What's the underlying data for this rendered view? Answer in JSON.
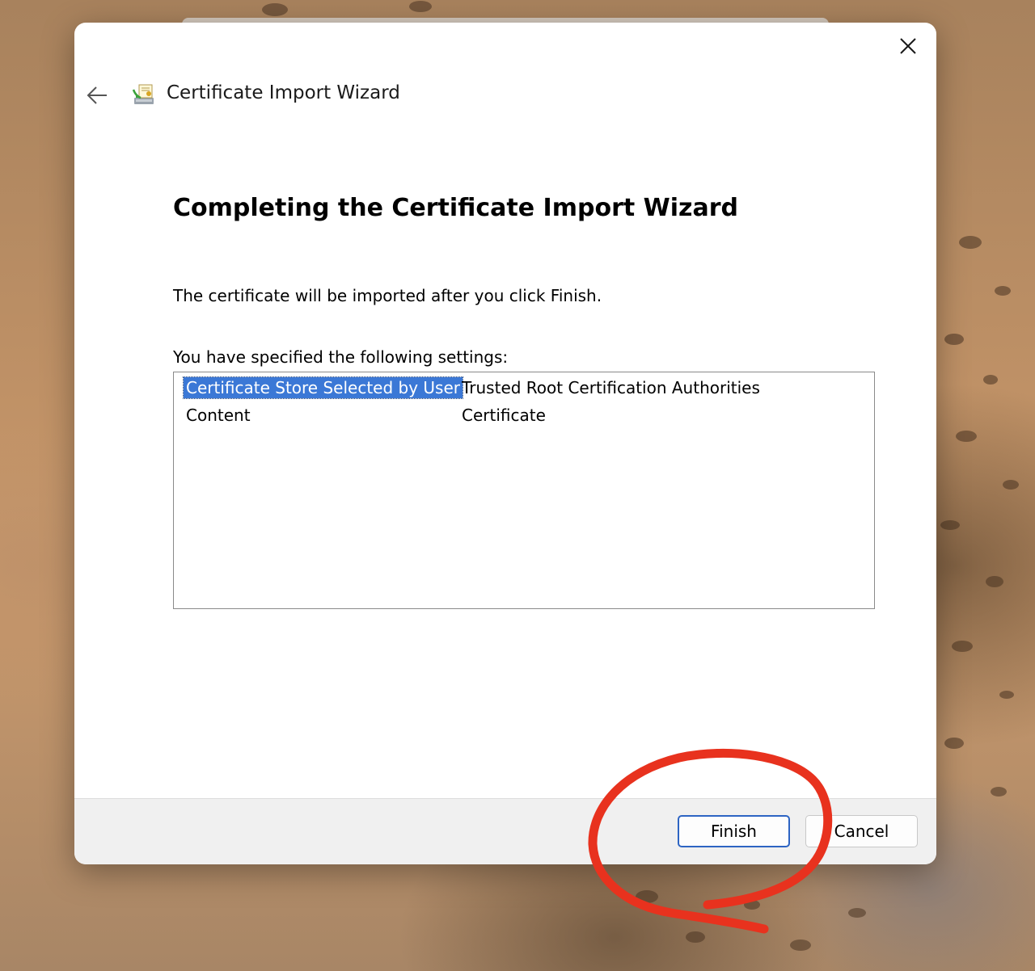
{
  "wizard": {
    "title": "Certificate Import Wizard",
    "page_title": "Completing the Certificate Import Wizard",
    "info_text": "The certificate will be imported after you click Finish.",
    "settings_label": "You have specified the following settings:",
    "settings": [
      {
        "key": "Certificate Store Selected by User",
        "value": "Trusted Root Certification Authorities",
        "selected": true
      },
      {
        "key": "Content",
        "value": "Certificate",
        "selected": false
      }
    ]
  },
  "buttons": {
    "finish_label": "Finish",
    "cancel_label": "Cancel"
  },
  "icons": {
    "back": "arrow-left-icon",
    "close": "close-icon",
    "wizard": "certificate-wizard-icon"
  },
  "colors": {
    "selection": "#3b78d6",
    "primary_border": "#2d64c3",
    "annotation": "#e8321e"
  }
}
